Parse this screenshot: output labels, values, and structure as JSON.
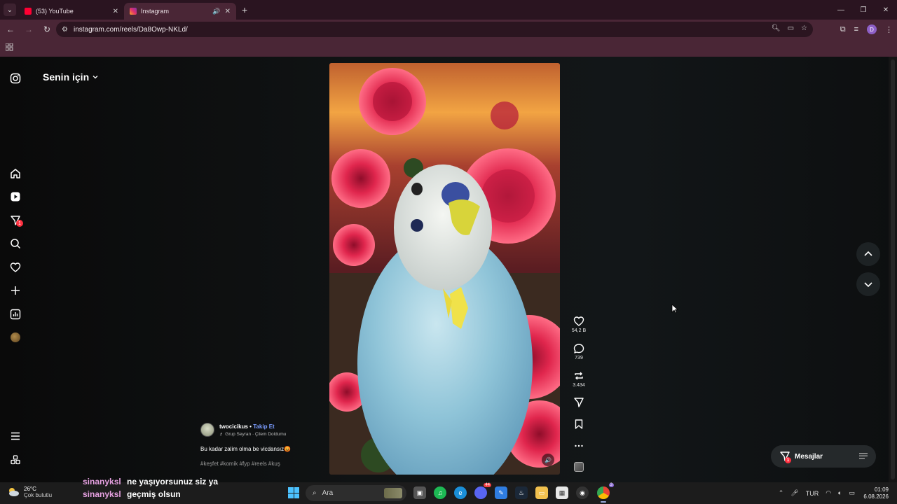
{
  "browser": {
    "tabs": [
      {
        "title": "(53) YouTube",
        "active": false,
        "favicon": "youtube-icon"
      },
      {
        "title": "Instagram",
        "active": true,
        "favicon": "instagram-icon"
      }
    ],
    "url": "instagram.com/reels/Da8Owp-NKLd/",
    "profile_initial": "D"
  },
  "instagram": {
    "feed_title": "Senin için",
    "sidebar": [
      "instagram-logo",
      "home",
      "reels",
      "messages",
      "search",
      "notifications",
      "create",
      "dashboard",
      "profile",
      "more",
      "also-from-meta"
    ],
    "messages_badge": "1",
    "reel": {
      "likes": "54,2 B",
      "comments": "739",
      "reposts": "3.434",
      "username": "twocicikus",
      "separator": "•",
      "follow_label": "Takip Et",
      "audio": "♬ Grup Seyran · Çilem Doldumu",
      "caption": "Bu kadar zalim olma be vicdansız😡",
      "hashtags": "#keşfet #komik #fyp #reels #kuş"
    },
    "messages_button": "Mesajlar"
  },
  "chat_overlay": [
    {
      "user": "sinanyksl",
      "message": "ne yaşıyorsunuz siz ya"
    },
    {
      "user": "sinanyksl",
      "message": "geçmiş olsun"
    }
  ],
  "taskbar": {
    "temperature": "26°C",
    "weather": "Çok bulutlu",
    "search_placeholder": "Ara",
    "language": "TUR",
    "time": "01:09",
    "date": "6.08.2026",
    "discord_badge": "44",
    "chrome_badge": "3"
  },
  "colors": {
    "chrome_tab_bar": "#2a1420",
    "chrome_toolbar": "#4a2636",
    "instagram_bg": "#0c0c0c",
    "follow_link": "#7a9cff",
    "notification_red": "#ff3040",
    "chat_user": "#e6a1e1"
  }
}
